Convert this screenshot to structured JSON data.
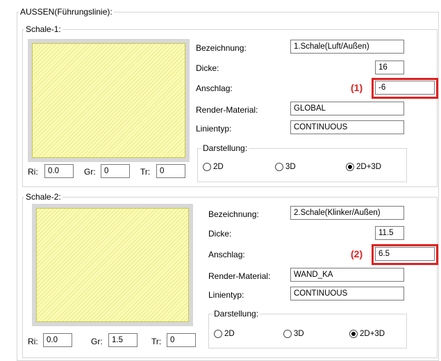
{
  "outer_group": {
    "title": "AUSSEN(Führungslinie):"
  },
  "shells": [
    {
      "title": "Schale-1:",
      "labels": {
        "name": "Bezeichnung:",
        "thickness": "Dicke:",
        "offset": "Anschlag:",
        "material": "Render-Material:",
        "linetype": "Linientyp:"
      },
      "values": {
        "name": "1.Schale(Luft/Außen)",
        "thickness": "16",
        "offset": "-6",
        "material": "GLOBAL",
        "linetype": "CONTINUOUS"
      },
      "display": {
        "title": "Darstellung:",
        "options": [
          "2D",
          "3D",
          "2D+3D"
        ],
        "selected": "2D+3D"
      },
      "rgb": {
        "ri_label": "Ri:",
        "ri": "0.0",
        "gr_label": "Gr:",
        "gr": "0",
        "tr_label": "Tr:",
        "tr": "0"
      },
      "annotation": "(1)"
    },
    {
      "title": "Schale-2:",
      "labels": {
        "name": "Bezeichnung:",
        "thickness": "Dicke:",
        "offset": "Anschlag:",
        "material": "Render-Material:",
        "linetype": "Linientyp:"
      },
      "values": {
        "name": "2.Schale(Klinker/Außen)",
        "thickness": "11.5",
        "offset": "6.5",
        "material": "WAND_KA",
        "linetype": "CONTINUOUS"
      },
      "display": {
        "title": "Darstellung:",
        "options": [
          "2D",
          "3D",
          "2D+3D"
        ],
        "selected": "2D+3D"
      },
      "rgb": {
        "ri_label": "Ri:",
        "ri": "0.0",
        "gr_label": "Gr:",
        "gr": "1.5",
        "tr_label": "Tr:",
        "tr": "0"
      },
      "annotation": "(2)"
    }
  ],
  "colors": {
    "annotation": "#e02020",
    "preview_fill": "#fbfbb8"
  }
}
